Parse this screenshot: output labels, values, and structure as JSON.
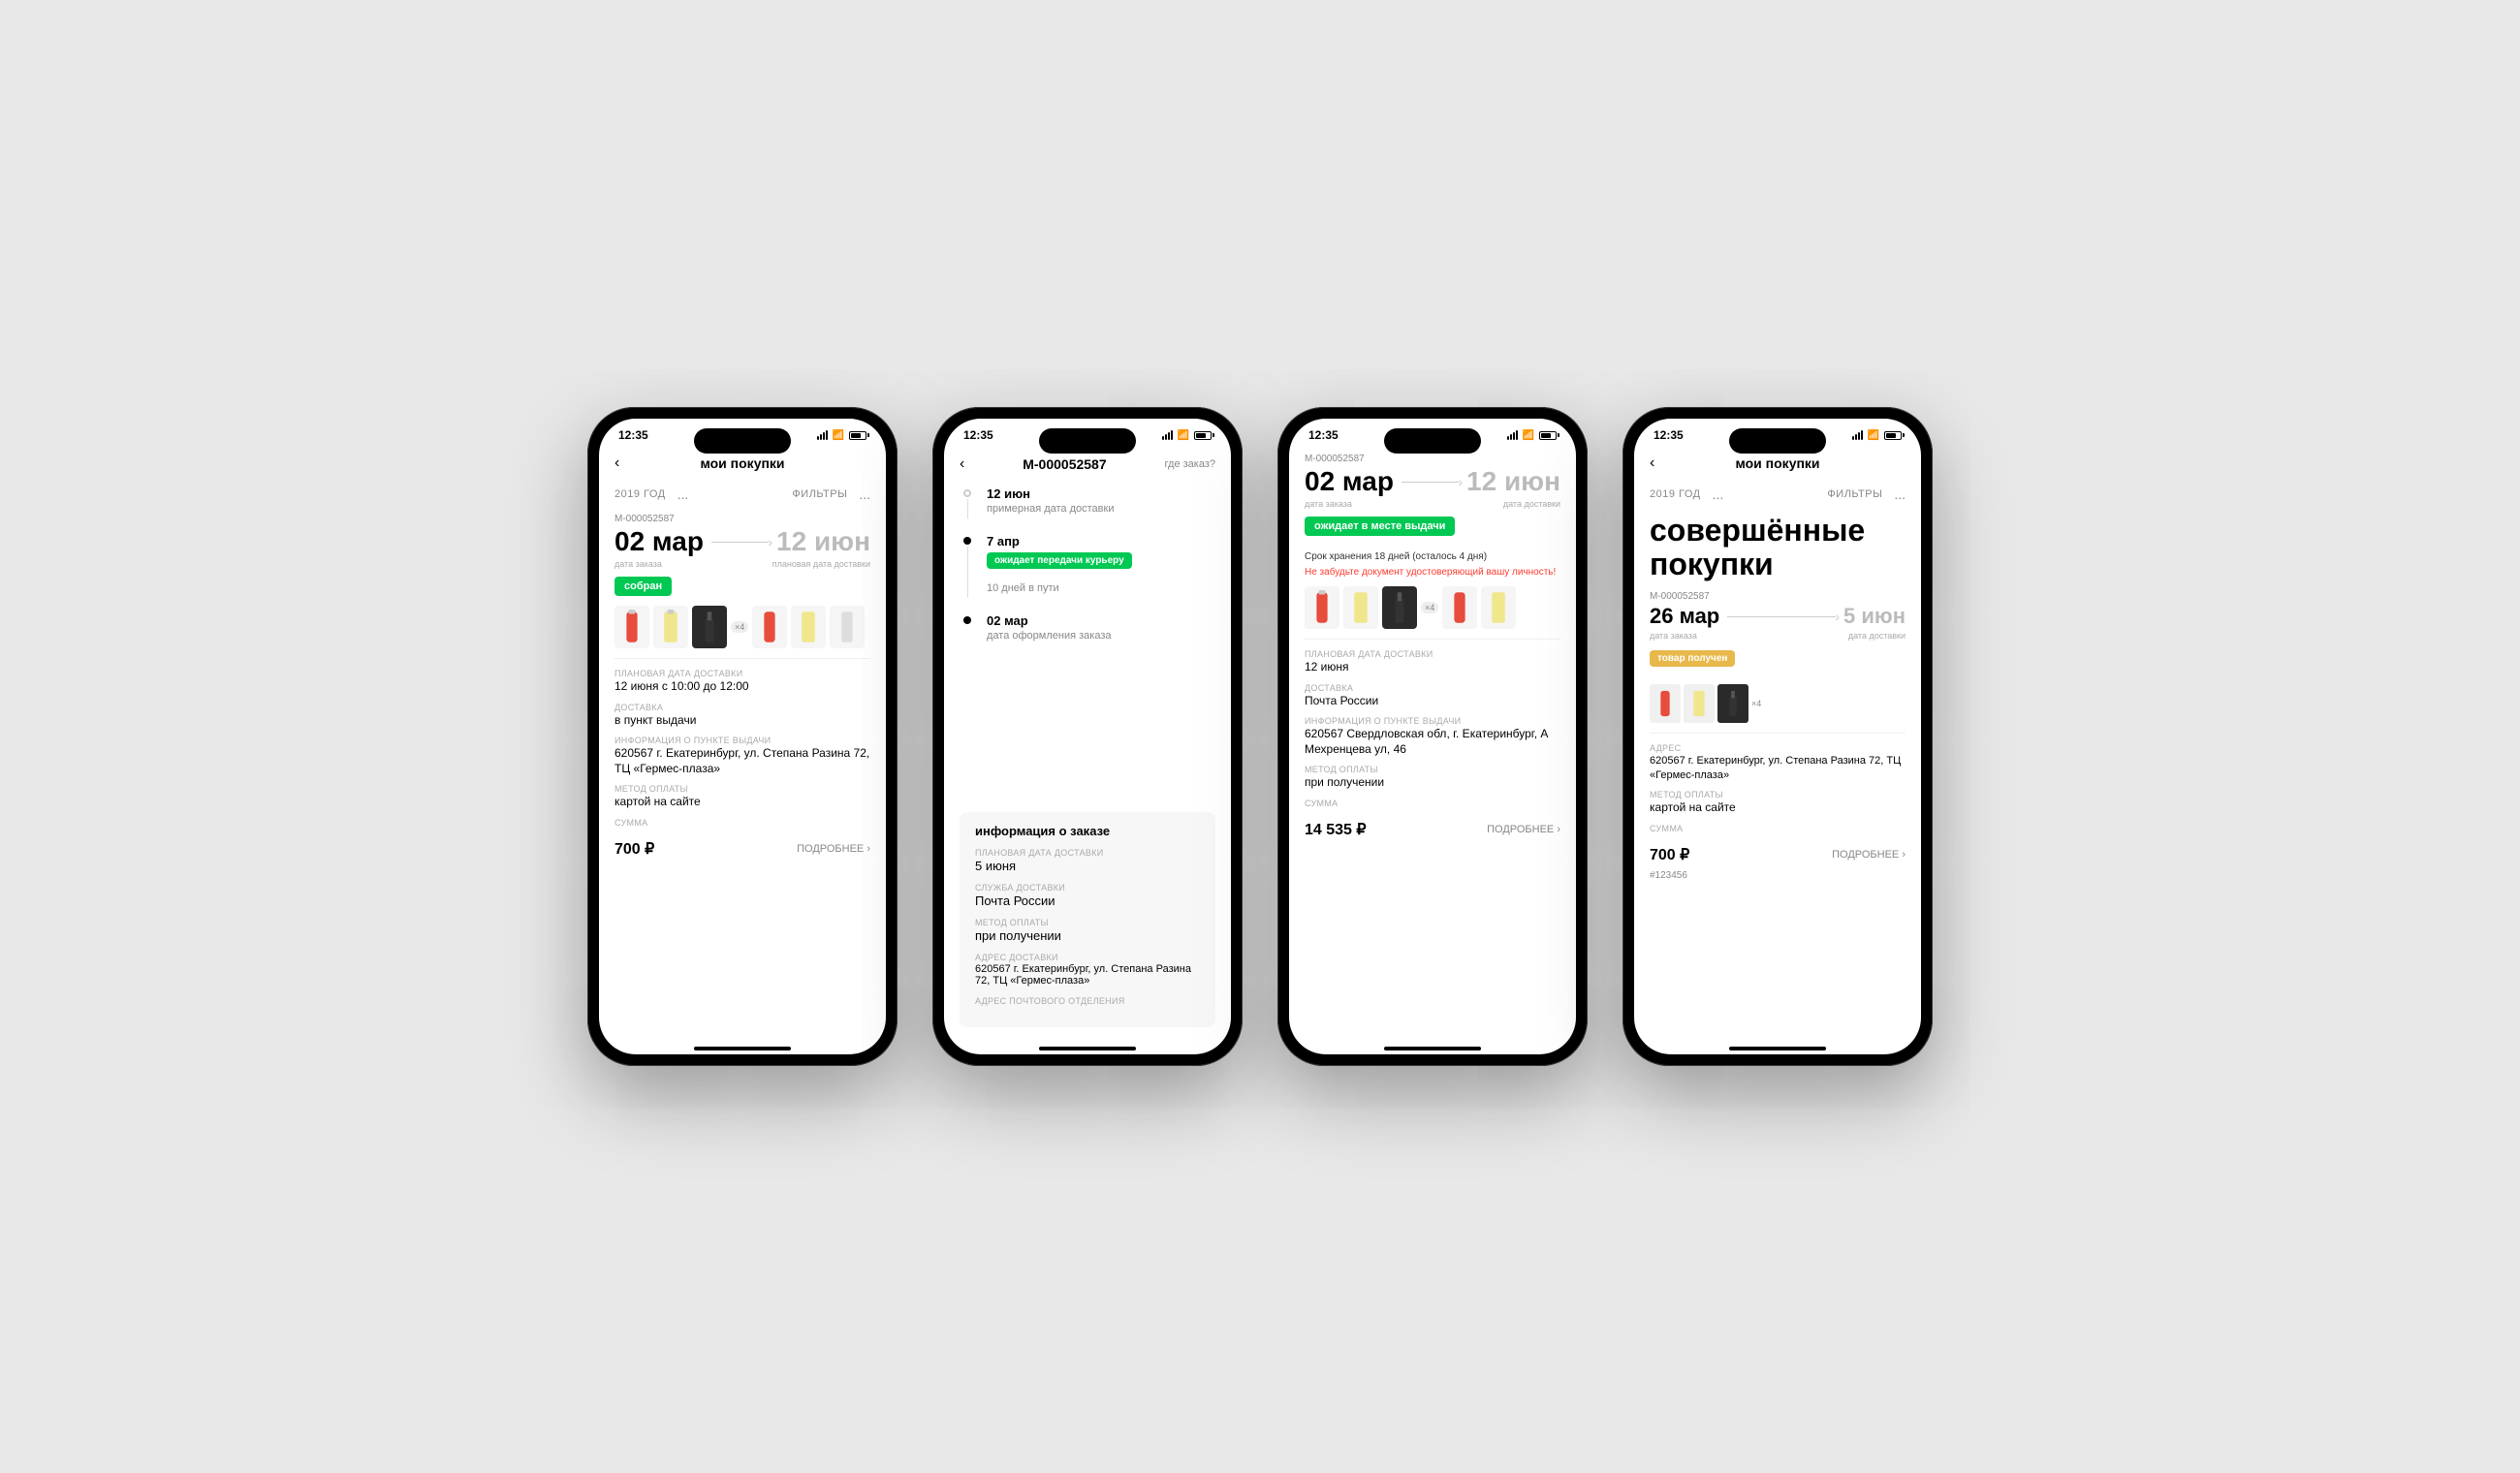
{
  "background": "#e8e8e8",
  "phones": [
    {
      "id": "phone1",
      "status_time": "12:35",
      "title": "мои покупки",
      "year_label": "2019 ГОД",
      "dots1": "...",
      "filter_label": "ФИЛЬТРЫ",
      "dots2": "...",
      "order_number": "М-000052587",
      "date_start": "02 мар",
      "date_end": "12 июн",
      "date_start_label": "дата заказа",
      "date_end_label": "плановая дата доставки",
      "status_badge": "собран",
      "badge_color": "green",
      "planned_delivery_label": "ПЛАНОВАЯ ДАТА ДОСТАВКИ",
      "planned_delivery_value": "12 июня с 10:00 до 12:00",
      "delivery_label": "ДОСТАВКА",
      "delivery_value": "в пункт выдачи",
      "pickup_label": "ИНФОРМАЦИЯ О ПУНКТЕ ВЫДАЧИ",
      "pickup_value": "620567 г. Екатеринбург, ул. Степана Разина 72, ТЦ «Гермес-плаза»",
      "payment_label": "МЕТОД ОПЛАТЫ",
      "payment_value": "картой на сайте",
      "sum_label": "СУММА",
      "sum_value": "700 ₽",
      "podrobnee": "ПОДРОБНЕЕ ›"
    },
    {
      "id": "phone2",
      "status_time": "12:35",
      "title": "М-000052587",
      "where_order": "где заказ?",
      "timeline": [
        {
          "date": "12 июн",
          "desc": "примерная дата доставки",
          "badge": null
        },
        {
          "date": "7 апр",
          "desc": null,
          "badge": "ожидает передачи курьеру",
          "badge_color": "green",
          "extra": "10 дней в пути"
        },
        {
          "date": "02 мар",
          "desc": "дата оформления заказа",
          "badge": null
        }
      ],
      "info_block_title": "информация о заказе",
      "planned_delivery_label": "ПЛАНОВАЯ ДАТА ДОСТАВКИ",
      "planned_delivery_value": "5 июня",
      "service_label": "СЛУЖБА ДОСТАВКИ",
      "service_value": "Почта России",
      "payment_label": "МЕТОД ОПЛАТЫ",
      "payment_value": "при получении",
      "address_label": "АДРЕС ДОСТАВКИ",
      "address_value": "620567 г. Екатеринбург, ул. Степана Разина 72, ТЦ «Гермес-плаза»",
      "post_label": "АДРЕС ПОЧТОВОГО ОТДЕЛЕНИЯ"
    },
    {
      "id": "phone3",
      "status_time": "12:35",
      "order_number": "М-000052587",
      "date_start": "02 мар",
      "date_end": "12 июн",
      "date_start_label": "дата заказа",
      "date_end_label": "дата доставки",
      "status_badge": "ожидает в месте выдачи",
      "badge_color": "green",
      "storage_notice": "Срок хранения 18 дней (осталось 4 дня)",
      "warning_text": "Не забудьте документ удостоверяющий вашу личность!",
      "planned_delivery_label": "ПЛАНОВАЯ ДАТА ДОСТАВКИ",
      "planned_delivery_value": "12 июня",
      "delivery_label": "ДОСТАВКА",
      "delivery_value": "Почта России",
      "pickup_label": "ИНФОРМАЦИЯ О ПУНКТЕ ВЫДАЧИ",
      "pickup_value": "620567 Свердловская обл, г. Екатеринбург, А Мехренцева ул, 46",
      "payment_label": "МЕТОД ОПЛАТЫ",
      "payment_value": "при получении",
      "sum_label": "СУММА",
      "sum_value": "14 535 ₽",
      "podrobnee": "ПОДРОБНЕЕ ›"
    },
    {
      "id": "phone4",
      "status_time": "12:35",
      "title": "мои покупки",
      "year_label": "2019 ГОД",
      "dots1": "...",
      "filter_label": "ФИЛЬТРЫ",
      "dots2": "...",
      "big_heading": "совершённые покупки",
      "order_number": "М-000052587",
      "date_start": "26 мар",
      "date_end": "5 июн",
      "date_start_label": "дата заказа",
      "date_end_label": "дата доставки",
      "status_badge": "товар получен",
      "badge_color": "yellow",
      "address_label": "АДРЕС",
      "address_value": "620567 г. Екатеринбург, ул. Степана Разина 72,  ТЦ «Гермес-плаза»",
      "payment_label": "МЕТОД ОПЛАТЫ",
      "payment_value": "картой на сайте",
      "sum_label": "СУММА",
      "sum_value": "700 ₽",
      "podrobnee": "ПОДРОБНЕЕ ›",
      "order_id_bottom": "#123456"
    }
  ]
}
